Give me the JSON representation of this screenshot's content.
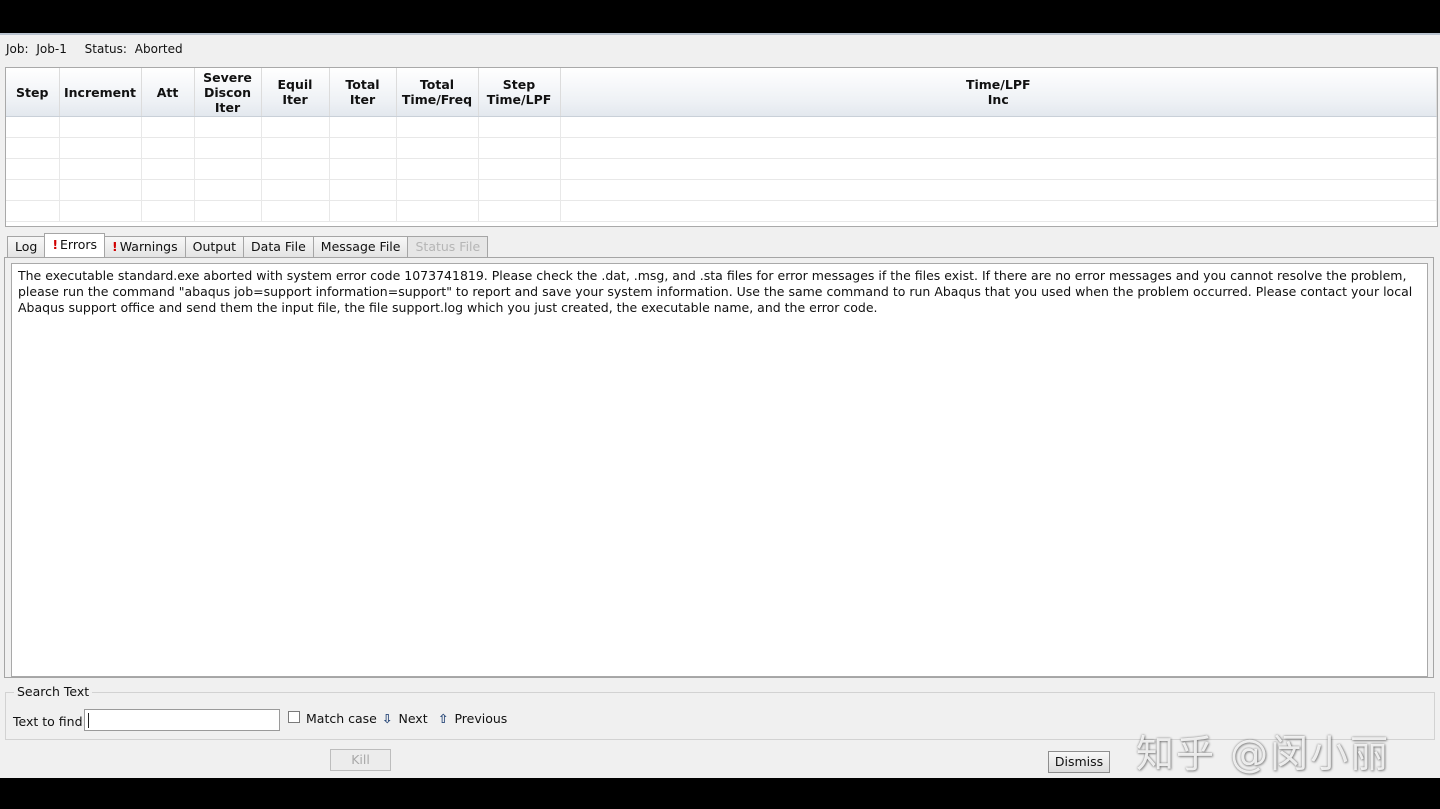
{
  "job": {
    "job_label": "Job:",
    "job_name": "Job-1",
    "status_label": "Status:",
    "status_value": "Aborted"
  },
  "monitor": {
    "columns": [
      [
        "Step"
      ],
      [
        "Increment"
      ],
      [
        "Att"
      ],
      [
        "Severe",
        "Discon",
        "Iter"
      ],
      [
        "Equil",
        "Iter"
      ],
      [
        "Total",
        "Iter"
      ],
      [
        "Total",
        "Time/Freq"
      ],
      [
        "Step",
        "Time/LPF"
      ],
      [
        "Time/LPF",
        "Inc"
      ]
    ],
    "empty_rows": 5
  },
  "tabs": [
    {
      "label": "Log",
      "warn": false,
      "active": false,
      "disabled": false
    },
    {
      "label": "Errors",
      "warn": true,
      "active": true,
      "disabled": false
    },
    {
      "label": "Warnings",
      "warn": true,
      "active": false,
      "disabled": false
    },
    {
      "label": "Output",
      "warn": false,
      "active": false,
      "disabled": false
    },
    {
      "label": "Data File",
      "warn": false,
      "active": false,
      "disabled": false
    },
    {
      "label": "Message File",
      "warn": false,
      "active": false,
      "disabled": false
    },
    {
      "label": "Status File",
      "warn": false,
      "active": false,
      "disabled": true
    }
  ],
  "warn_mark": "!",
  "error_text": "The executable standard.exe aborted with system error code 1073741819. Please check the .dat, .msg, and .sta files for error messages if the files exist.  If there are no error messages and you cannot resolve the problem, please run the command \"abaqus job=support information=support\" to report and save your system information.  Use the same command to run Abaqus that you used when the problem occurred.  Please contact your local Abaqus support office and send them the input file, the file support.log which you just created, the executable name, and the error code.",
  "search": {
    "group_title": "Search Text",
    "find_label": "Text to find:",
    "find_value": "",
    "match_case_label": "Match case",
    "match_case_checked": false,
    "next_label": "Next",
    "previous_label": "Previous",
    "next_icon": "down-arrow-icon",
    "previous_icon": "up-arrow-icon"
  },
  "buttons": {
    "kill": "Kill",
    "dismiss": "Dismiss"
  },
  "watermark": "知乎 @闵小丽"
}
